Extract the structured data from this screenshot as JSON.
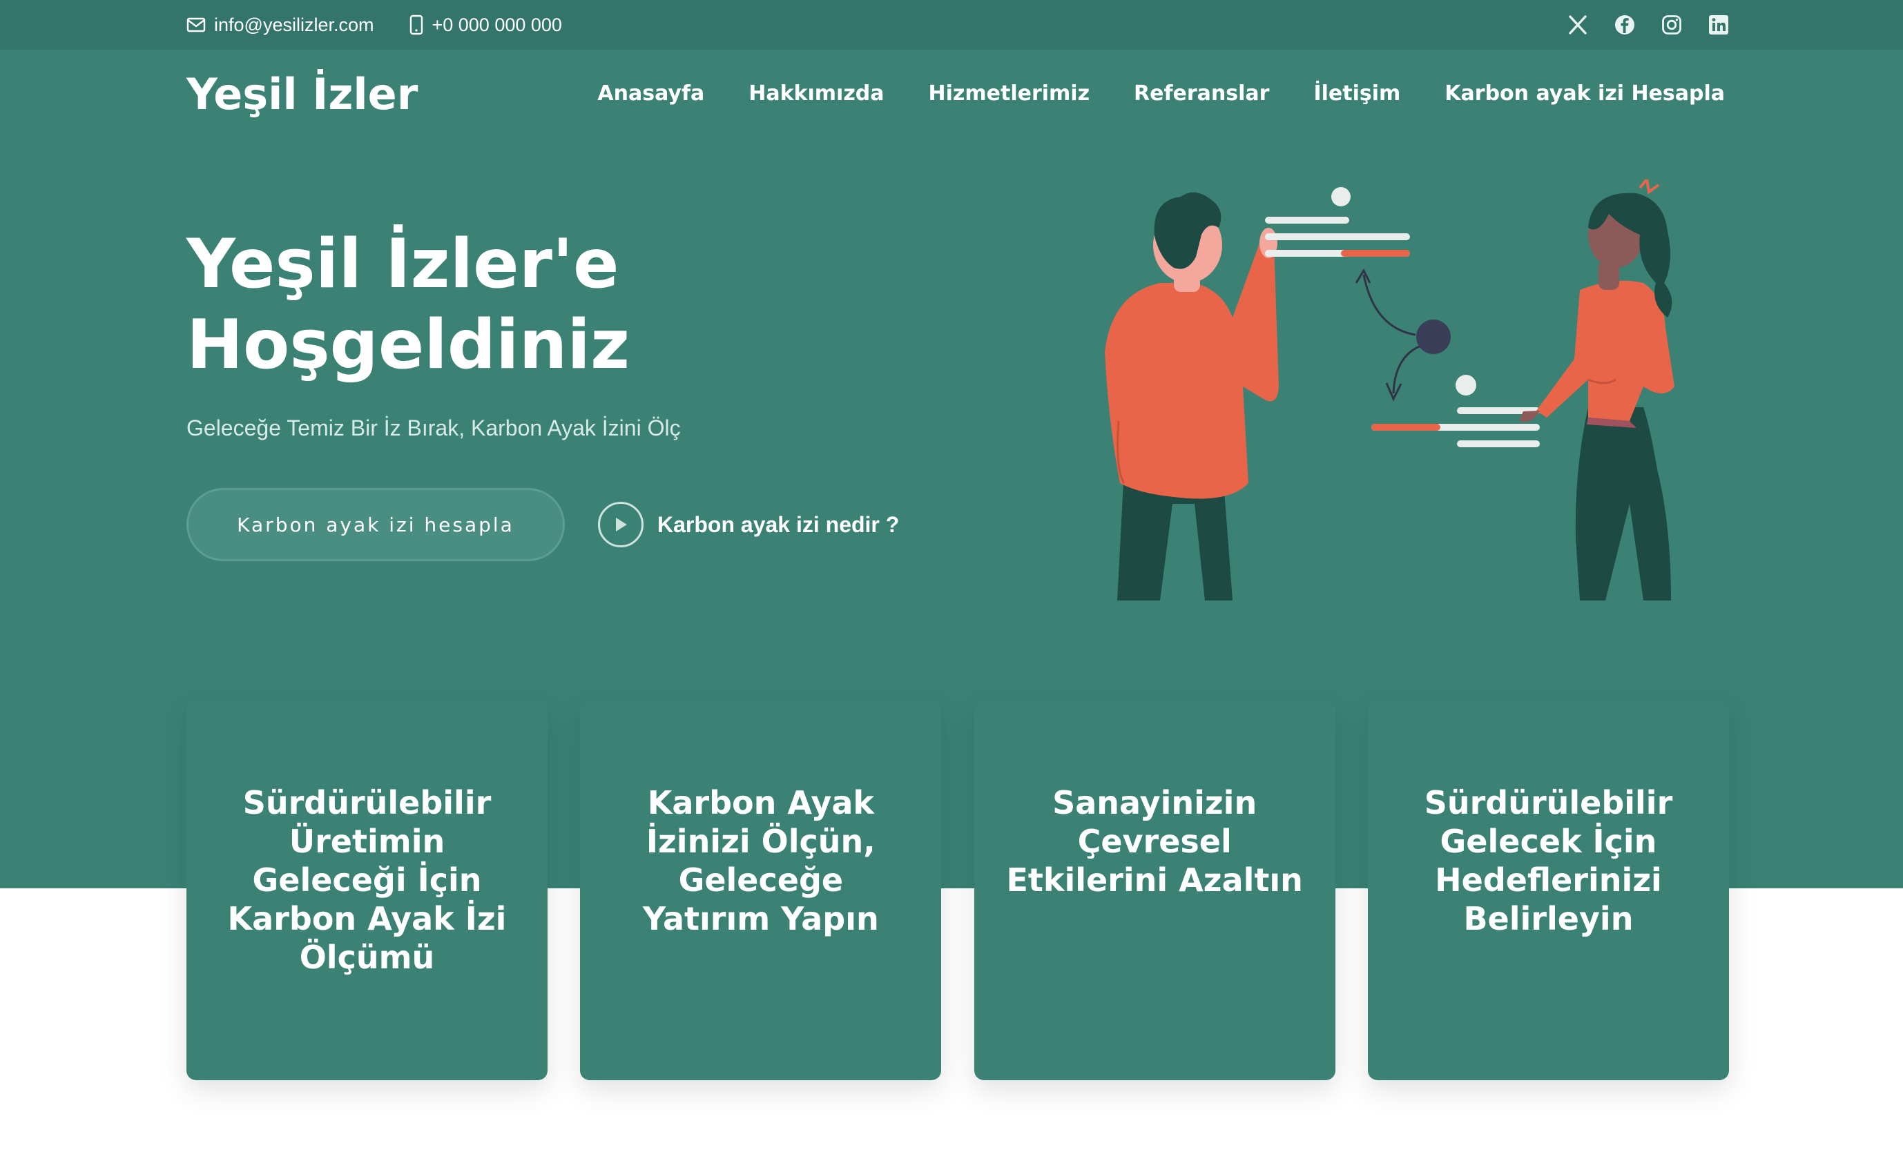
{
  "topbar": {
    "email": "info@yesilizler.com",
    "phone": "+0 000 000 000",
    "social_icons": [
      "x-icon",
      "facebook-icon",
      "instagram-icon",
      "linkedin-icon"
    ]
  },
  "header": {
    "logo": "Yeşil İzler",
    "nav": [
      "Anasayfa",
      "Hakkımızda",
      "Hizmetlerimiz",
      "Referanslar",
      "İletişim",
      "Karbon ayak izi Hesapla"
    ]
  },
  "hero": {
    "title_line1": "Yeşil İzler'e",
    "title_line2": "Hoşgeldiniz",
    "subtitle": "Geleceğe Temiz Bir İz Bırak, Karbon Ayak İzini Ölç",
    "cta_label": "Karbon ayak izi hesapla",
    "video_label": "Karbon ayak izi nedir ?"
  },
  "cards": [
    {
      "title": "Sürdürülebilir Üretimin Geleceği İçin Karbon Ayak İzi Ölçümü"
    },
    {
      "title": "Karbon Ayak İzinizi Ölçün, Geleceğe Yatırım Yapın"
    },
    {
      "title": "Sanayinizin Çevresel Etkilerini Azaltın"
    },
    {
      "title": "Sürdürülebilir Gelecek İçin Hedeflerinizi Belirleyin"
    }
  ],
  "colors": {
    "topbar": "#33756a",
    "hero": "#3b8275",
    "accent": "#e8654a",
    "dark_green": "#1d4a42"
  }
}
